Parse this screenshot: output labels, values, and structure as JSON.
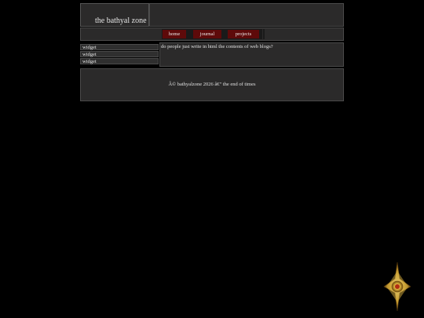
{
  "header": {
    "site_title": "the bathyal zone"
  },
  "nav": {
    "items": [
      {
        "label": "home"
      },
      {
        "label": "journal"
      },
      {
        "label": "projects"
      }
    ]
  },
  "sidebar": {
    "widgets": [
      {
        "label": "widget"
      },
      {
        "label": "widget"
      },
      {
        "label": "widget"
      }
    ]
  },
  "main": {
    "text": "do people just write in html the contents of web blogs?"
  },
  "footer": {
    "text": "Â© bathyalzone 2026 â€\" the end of times"
  },
  "colors": {
    "background": "#000000",
    "panel": "#2b2a2a",
    "nav_button": "#5e0a0a",
    "ornament_gold": "#c8a23a"
  },
  "icons": {
    "ornament": "golden-sun-icon"
  }
}
